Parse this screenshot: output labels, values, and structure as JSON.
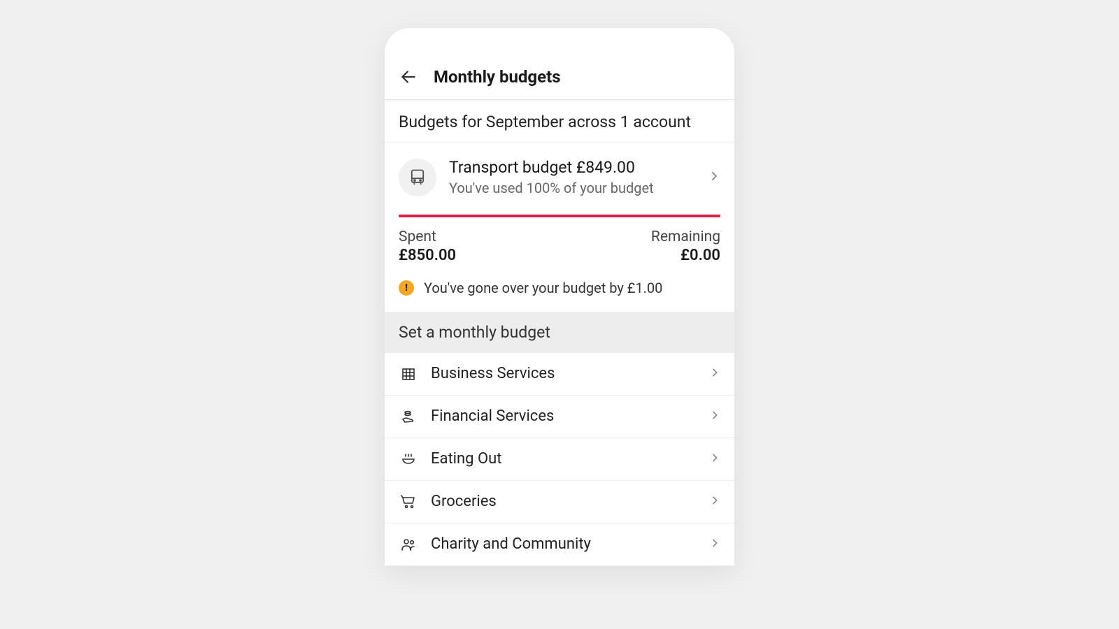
{
  "header": {
    "title": "Monthly budgets"
  },
  "summary": "Budgets for September across 1 account",
  "budget": {
    "title": "Transport budget £849.00",
    "subtitle": "You've used 100% of your budget",
    "spent_label": "Spent",
    "spent_value": "£850.00",
    "remaining_label": "Remaining",
    "remaining_value": "£0.00",
    "alert": "You've gone over your budget by £1.00",
    "progress_color": "#db1e4a",
    "alert_color": "#f5a623"
  },
  "set_section_title": "Set a monthly budget",
  "categories": [
    {
      "label": "Business Services"
    },
    {
      "label": "Financial Services"
    },
    {
      "label": "Eating Out"
    },
    {
      "label": "Groceries"
    },
    {
      "label": "Charity and Community"
    }
  ]
}
